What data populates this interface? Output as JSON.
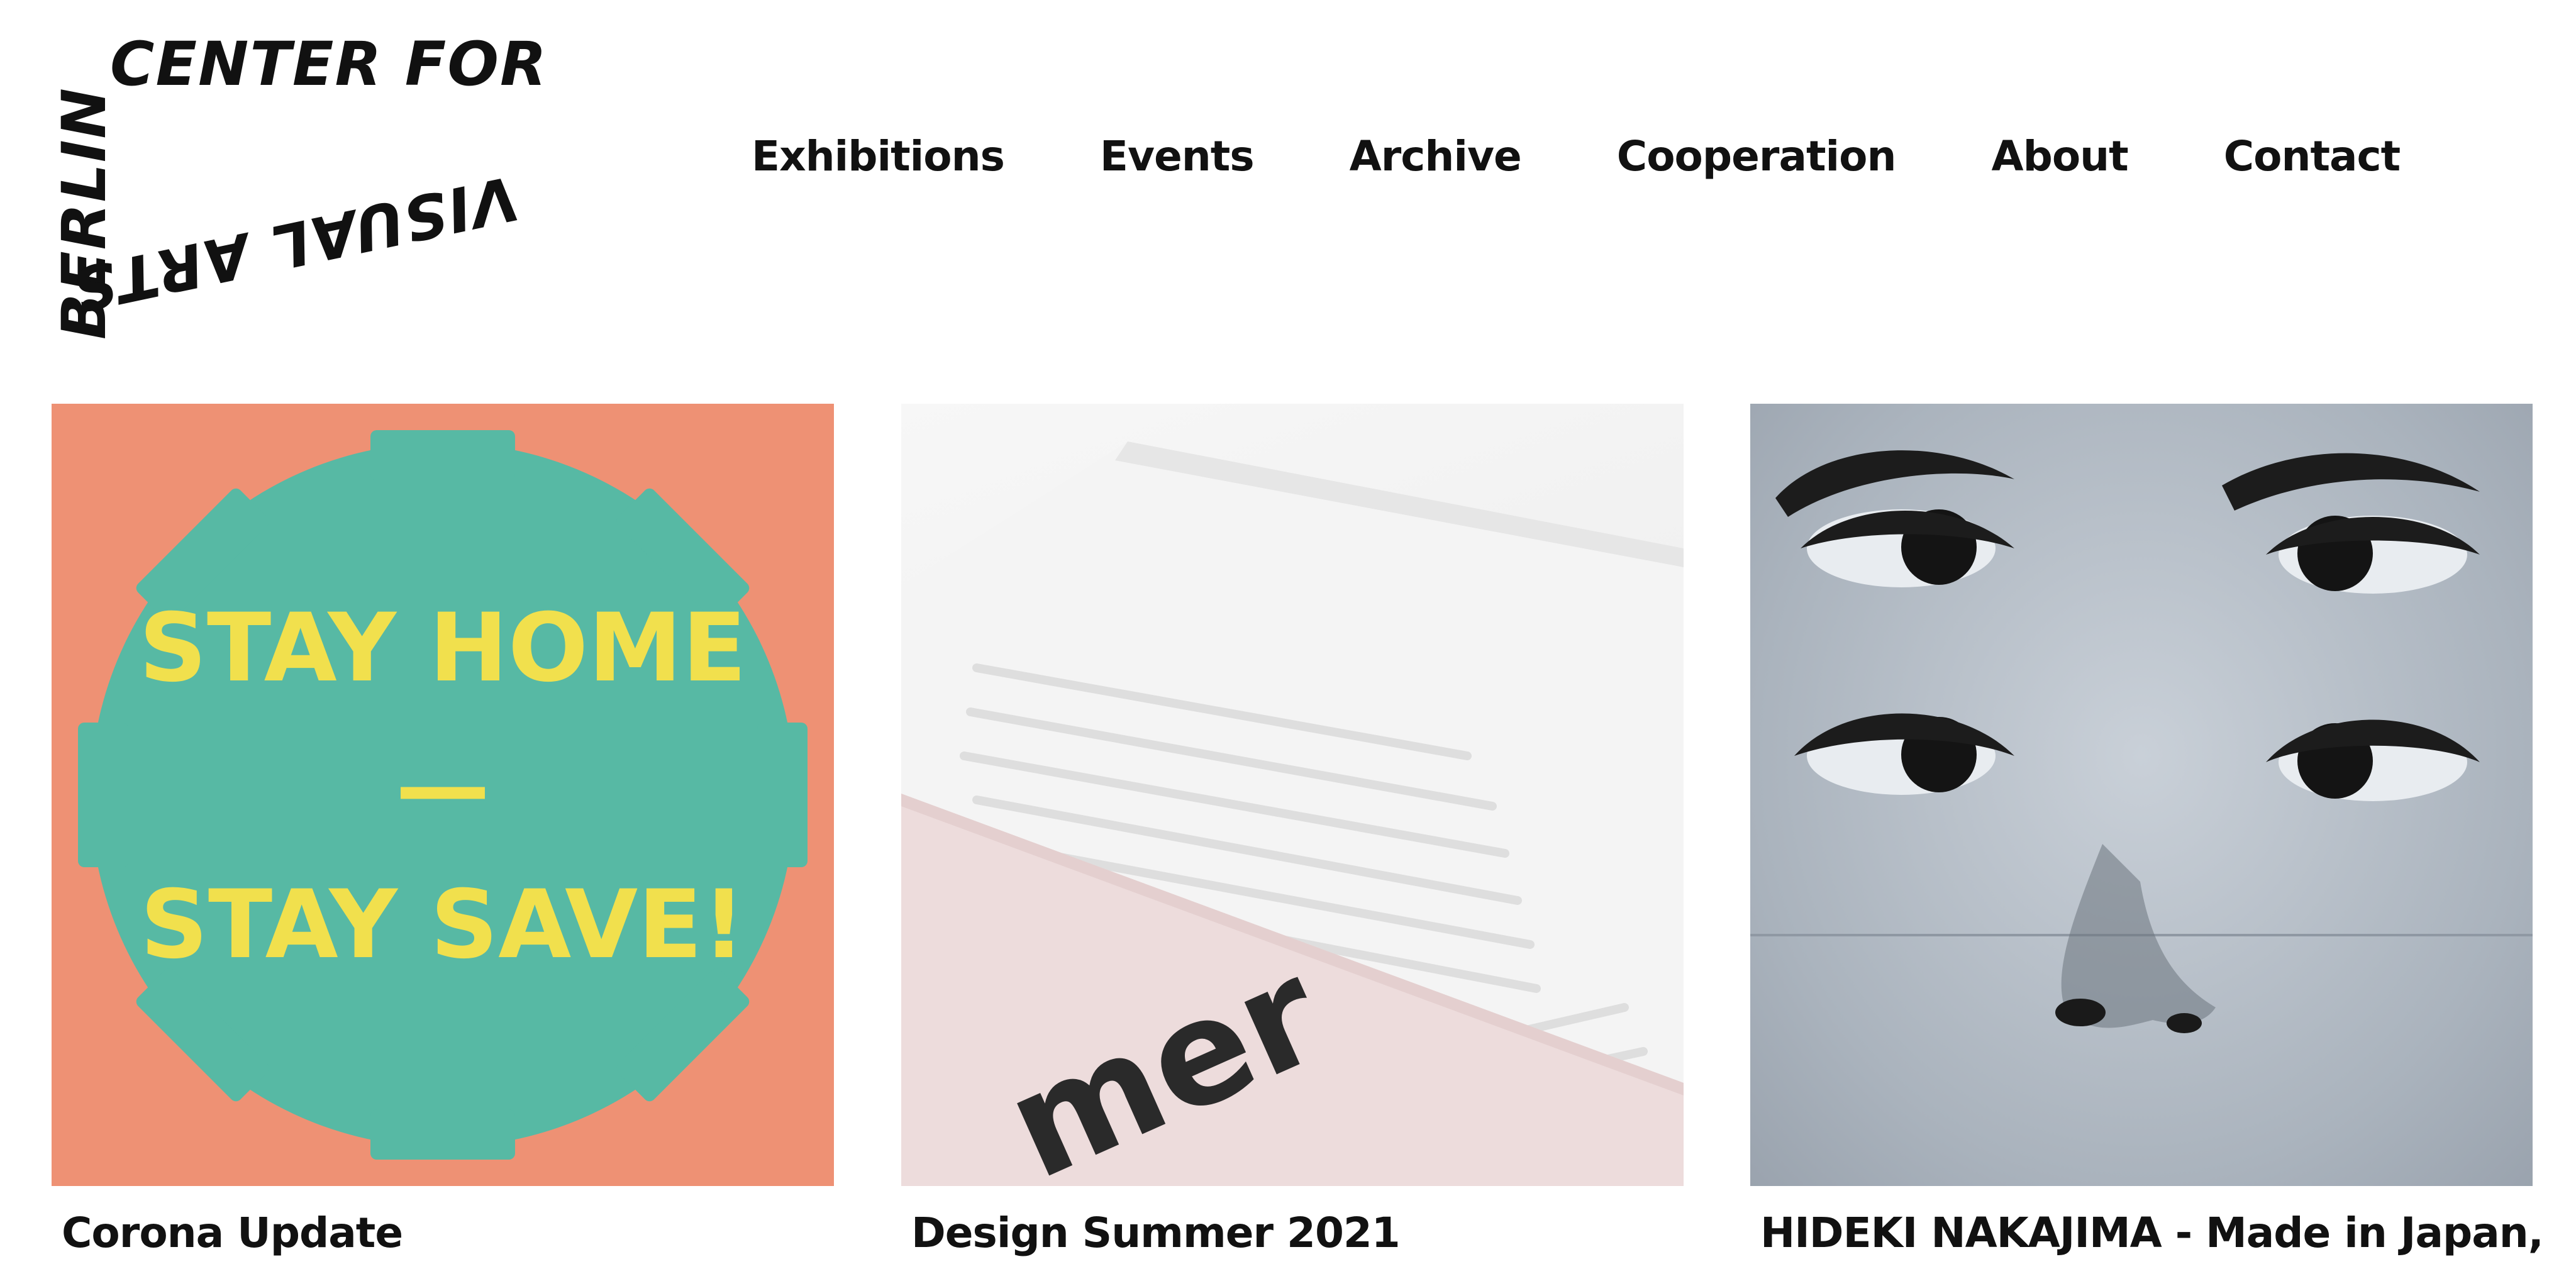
{
  "logo": {
    "line_top": "CENTER FOR",
    "line_bottom": "VISUAL ARTS",
    "line_left": "BERLIN"
  },
  "nav": {
    "items": [
      {
        "label": "Exhibitions"
      },
      {
        "label": "Events"
      },
      {
        "label": "Archive"
      },
      {
        "label": "Cooperation"
      },
      {
        "label": "About"
      },
      {
        "label": "Contact"
      }
    ]
  },
  "cards": [
    {
      "title": "Corona Update",
      "image": {
        "line1": "STAY HOME",
        "divider": "—",
        "line2": "STAY SAVE!",
        "background": "#ee9174",
        "badge_color": "#57b9a4",
        "text_color": "#f1e04d"
      }
    },
    {
      "title": "Design Summer 2021",
      "image": {
        "fragment_text": "mer"
      }
    },
    {
      "title": "HIDEKI NAKAJIMA - Made in Japan,"
    }
  ]
}
